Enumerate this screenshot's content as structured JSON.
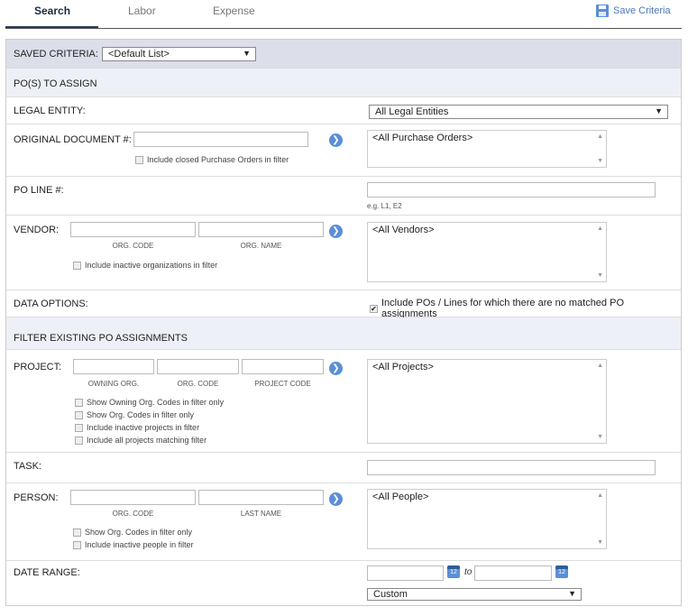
{
  "tabs": [
    {
      "label": "Search"
    },
    {
      "label": "Labor"
    },
    {
      "label": "Expense"
    }
  ],
  "save_criteria": {
    "label": "Save Criteria",
    "icon": "floppy-disk-icon"
  },
  "saved_criteria": {
    "label": "SAVED CRITERIA:",
    "value": "<Default List>"
  },
  "sections": {
    "pos_to_assign": "PO(S) TO ASSIGN",
    "filter_existing": "FILTER EXISTING PO ASSIGNMENTS"
  },
  "legal_entity": {
    "label": "LEGAL ENTITY:",
    "value": "All Legal Entities"
  },
  "original_document": {
    "label": "ORIGINAL DOCUMENT #:",
    "checkbox": "Include closed Purchase Orders in filter",
    "list": "<All Purchase Orders>"
  },
  "po_line": {
    "label": "PO LINE #:",
    "hint": "e.g. L1, E2"
  },
  "vendor": {
    "label": "VENDOR:",
    "sub1": "ORG. CODE",
    "sub2": "ORG. NAME",
    "checkbox": "Include inactive organizations in filter",
    "list": "<All Vendors>"
  },
  "data_options": {
    "label": "DATA OPTIONS:",
    "checkbox": "Include POs / Lines for which there are no matched PO assignments",
    "checked": true
  },
  "project": {
    "label": "PROJECT:",
    "sub1": "OWNING ORG.",
    "sub2": "ORG. CODE",
    "sub3": "PROJECT CODE",
    "checkboxes": [
      "Show Owning Org. Codes in filter only",
      "Show Org. Codes in filter only",
      "Include inactive projects in filter",
      "Include all projects matching filter"
    ],
    "list": "<All Projects>"
  },
  "task": {
    "label": "TASK:"
  },
  "person": {
    "label": "PERSON:",
    "sub1": "ORG. CODE",
    "sub2": "LAST NAME",
    "checkboxes": [
      "Show Org. Codes in filter only",
      "Include inactive people in filter"
    ],
    "list": "<All People>"
  },
  "date_range": {
    "label": "DATE RANGE:",
    "to": "to",
    "calendar_day": "12",
    "value": "Custom"
  },
  "colors": {
    "accent": "#5b8fd6",
    "link": "#4a78b8",
    "section_bg": "#eef0f8"
  }
}
